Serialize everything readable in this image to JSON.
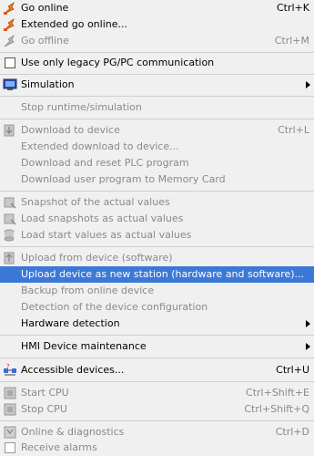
{
  "menu": {
    "items": [
      {
        "label": "Go online",
        "shortcut": "Ctrl+K",
        "enabled": true
      },
      {
        "label": "Extended go online...",
        "shortcut": "",
        "enabled": true
      },
      {
        "label": "Go offline",
        "shortcut": "Ctrl+M",
        "enabled": false
      },
      {
        "label": "Use only legacy PG/PC communication",
        "shortcut": "",
        "enabled": true,
        "checkbox": true
      },
      {
        "label": "Simulation",
        "shortcut": "",
        "enabled": true,
        "submenu": true
      },
      {
        "label": "Stop runtime/simulation",
        "shortcut": "",
        "enabled": false
      },
      {
        "label": "Download to device",
        "shortcut": "Ctrl+L",
        "enabled": false
      },
      {
        "label": "Extended download to device...",
        "shortcut": "",
        "enabled": false
      },
      {
        "label": "Download and reset PLC program",
        "shortcut": "",
        "enabled": false
      },
      {
        "label": "Download user program to Memory Card",
        "shortcut": "",
        "enabled": false
      },
      {
        "label": "Snapshot of the actual values",
        "shortcut": "",
        "enabled": false
      },
      {
        "label": "Load snapshots as actual values",
        "shortcut": "",
        "enabled": false
      },
      {
        "label": "Load start values as actual values",
        "shortcut": "",
        "enabled": false
      },
      {
        "label": "Upload from device (software)",
        "shortcut": "",
        "enabled": false
      },
      {
        "label": "Upload device as new station (hardware and software)...",
        "shortcut": "",
        "enabled": true,
        "highlighted": true
      },
      {
        "label": "Backup from online device",
        "shortcut": "",
        "enabled": false
      },
      {
        "label": "Detection of the device configuration",
        "shortcut": "",
        "enabled": false
      },
      {
        "label": "Hardware detection",
        "shortcut": "",
        "enabled": true,
        "submenu": true
      },
      {
        "label": "HMI Device maintenance",
        "shortcut": "",
        "enabled": true,
        "submenu": true
      },
      {
        "label": "Accessible devices...",
        "shortcut": "Ctrl+U",
        "enabled": true
      },
      {
        "label": "Start CPU",
        "shortcut": "Ctrl+Shift+E",
        "enabled": false
      },
      {
        "label": "Stop CPU",
        "shortcut": "Ctrl+Shift+Q",
        "enabled": false
      },
      {
        "label": "Online & diagnostics",
        "shortcut": "Ctrl+D",
        "enabled": false
      },
      {
        "label": "Receive alarms",
        "shortcut": "",
        "enabled": false
      }
    ]
  },
  "colors": {
    "highlight": "#3c78d8",
    "disabled_text": "#8a8a8a",
    "background": "#f0f0f0"
  }
}
